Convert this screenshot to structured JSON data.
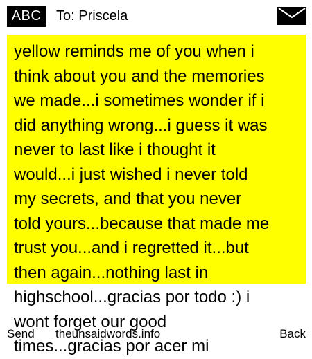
{
  "header": {
    "input_mode": "ABC",
    "to_label": "To: Priscela",
    "icon": "envelope-icon"
  },
  "message": {
    "lines": [
      "yellow reminds me of you when i",
      "think about you and the memories",
      "we made...i sometimes wonder if i",
      "did anything wrong...i guess it was",
      "never to last like i thought it",
      "would...i just wished i never told",
      "my secrets, and that you never",
      "told yours...because that made me",
      "trust you...and i regretted it...but",
      "then again...nothing last in",
      "highschool...gracias por todo :) i",
      "wont forget our good",
      "times...gracias por acer mi"
    ]
  },
  "footer": {
    "left_label": "Send",
    "center_label": "theunsaidwords.info",
    "right_label": "Back"
  },
  "colors": {
    "highlight": "#ffff00",
    "badge_bg": "#000000",
    "background": "#ffffff"
  }
}
